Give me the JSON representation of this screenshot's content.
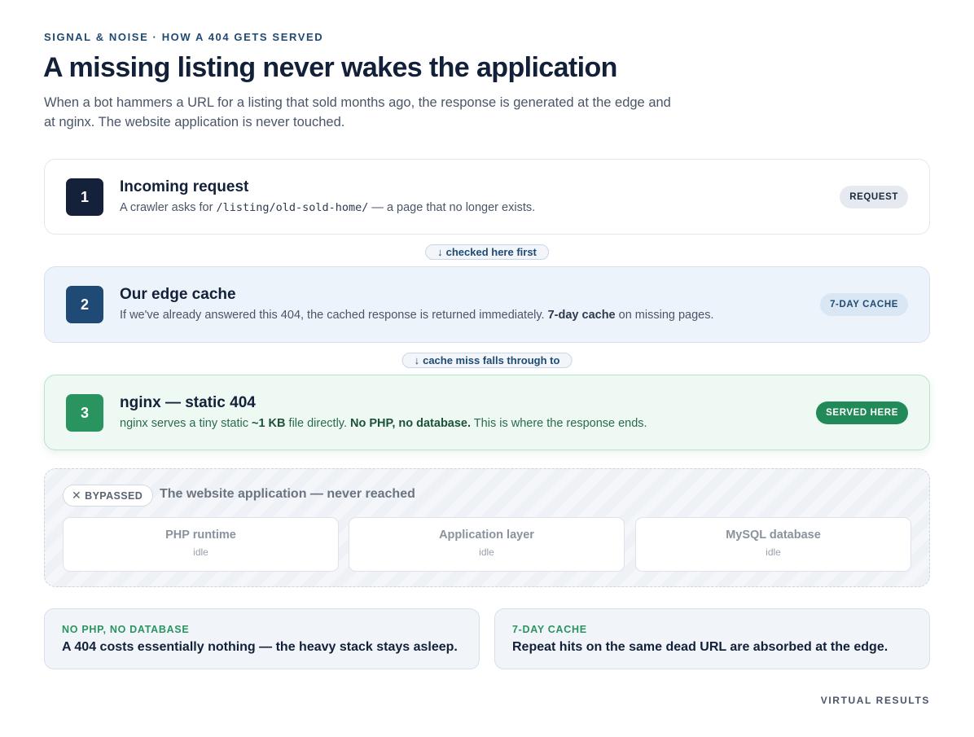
{
  "header": {
    "eyebrow": "SIGNAL & NOISE · HOW A 404 GETS SERVED",
    "title": "A missing listing never wakes the application",
    "lede": "When a bot hammers a URL for a listing that sold months ago, the response is generated at the edge and at nginx. The website application is never touched."
  },
  "stages": [
    {
      "number": "1",
      "title": "Incoming request",
      "desc_pre": "A crawler asks for ",
      "desc_code": "/listing/old-sold-home/",
      "desc_post": " — a page that no longer exists.",
      "pill": "REQUEST"
    },
    {
      "number": "2",
      "title": "Our edge cache",
      "desc_pre": "If we've already answered this 404, the cached response is returned immediately. ",
      "desc_bold": "7-day cache",
      "desc_post": " on missing pages.",
      "pill": "7-DAY CACHE"
    },
    {
      "number": "3",
      "title": "nginx — static 404",
      "desc_pre": "nginx serves a tiny static ",
      "desc_bold": "~1 KB",
      "desc_mid": " file directly. ",
      "desc_bold2": "No PHP, no database.",
      "desc_post": " This is where the response ends.",
      "pill": "SERVED HERE"
    }
  ],
  "connectors": [
    {
      "icon": "arrow-down-icon",
      "glyph": "↓",
      "label": "checked here first"
    },
    {
      "icon": "arrow-down-icon",
      "glyph": "↓",
      "label": "cache miss falls through to"
    }
  ],
  "bypassed": {
    "badge_icon": "close-icon",
    "badge_glyph": "✕",
    "badge": "BYPASSED",
    "title": "The website application — never reached",
    "components": [
      {
        "name": "PHP runtime",
        "state": "idle"
      },
      {
        "name": "Application layer",
        "state": "idle"
      },
      {
        "name": "MySQL database",
        "state": "idle"
      }
    ]
  },
  "notes": [
    {
      "label": "NO PHP, NO DATABASE",
      "text": "A 404 costs essentially nothing — the heavy stack stays asleep."
    },
    {
      "label": "7-DAY CACHE",
      "text": "Repeat hits on the same dead URL are absorbed at the edge."
    }
  ],
  "footer": {
    "brand": "VIRTUAL RESULTS"
  },
  "colors": {
    "navy": "#15203a",
    "edge_blue": "#1f4a75",
    "served_green": "#2a9461"
  }
}
